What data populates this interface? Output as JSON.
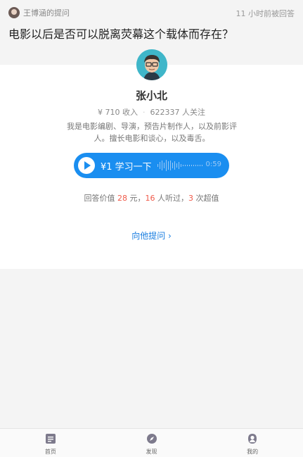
{
  "question": {
    "asker": "王博涵的提问",
    "answered_time": "11 小时前被回答",
    "title": "电影以后是否可以脱离荧幕这个载体而存在？"
  },
  "answerer": {
    "name": "张小北",
    "income": "¥ 710 收入",
    "followers": "622337 人关注",
    "bio": "我是电影编剧、导演，预告片制作人，以及前影评人。擅长电影和谈心，以及毒舌。"
  },
  "audio": {
    "label": "¥1 学习一下",
    "duration": "0:59"
  },
  "answer_value": {
    "prefix": "回答价值 ",
    "price": "28",
    "part2": " 元，",
    "listeners": "16",
    "part3": " 人听过，",
    "exceeded": "3",
    "part4": " 次超值"
  },
  "ask_him_label": "向他提问 ›",
  "tabbar": {
    "items": [
      {
        "label": "首页",
        "icon": "home-icon"
      },
      {
        "label": "发现",
        "icon": "compass-icon"
      },
      {
        "label": "我的",
        "icon": "profile-icon"
      }
    ]
  },
  "colors": {
    "accent": "#1a8ef0",
    "link": "#1a7ee0",
    "highlight": "#f05a4a"
  }
}
